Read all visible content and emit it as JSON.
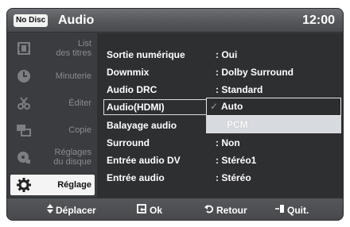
{
  "header": {
    "disc_badge": "No Disc",
    "title": "Audio",
    "clock": "12:00"
  },
  "sidebar": {
    "items": [
      {
        "label": "List des titres",
        "label_line1": "List",
        "label_line2": "des titres",
        "icon": "film-list-icon",
        "active": false
      },
      {
        "label": "Minuterie",
        "icon": "timer-icon",
        "active": false
      },
      {
        "label": "Éditer",
        "icon": "scissors-icon",
        "active": false
      },
      {
        "label": "Copie",
        "icon": "copy-icon",
        "active": false
      },
      {
        "label": "Réglages du disque",
        "label_line1": "Réglages",
        "label_line2": "du disque",
        "icon": "disc-settings-icon",
        "active": false
      },
      {
        "label": "Réglage",
        "icon": "gear-icon",
        "active": true
      }
    ]
  },
  "settings": {
    "rows": [
      {
        "key": "Sortie numérique",
        "value": ": Oui"
      },
      {
        "key": "Downmix",
        "value": ": Dolby Surround"
      },
      {
        "key": "Audio DRC",
        "value": ": Standard"
      },
      {
        "key": "Audio(HDMI)",
        "value": ""
      },
      {
        "key": "Balayage audio",
        "value": ""
      },
      {
        "key": "Surround",
        "value": ": Non"
      },
      {
        "key": "Entrée audio DV",
        "value": ": Stéréo1"
      },
      {
        "key": "Entrée audio",
        "value": ": Stéréo"
      }
    ],
    "dropdown": {
      "options": [
        "Auto",
        "PCM"
      ],
      "selected": "Auto",
      "check_glyph": "✓"
    }
  },
  "footer": {
    "move": "Déplacer",
    "ok": "Ok",
    "back": "Retour",
    "quit": "Quit."
  },
  "colors": {
    "header_bg": "#5b5d61",
    "panel_bg": "#2e2f31",
    "sidebar_bg": "#3a3c3f",
    "active_item_bg": "#f4f4f4",
    "text": "#ffffff"
  }
}
